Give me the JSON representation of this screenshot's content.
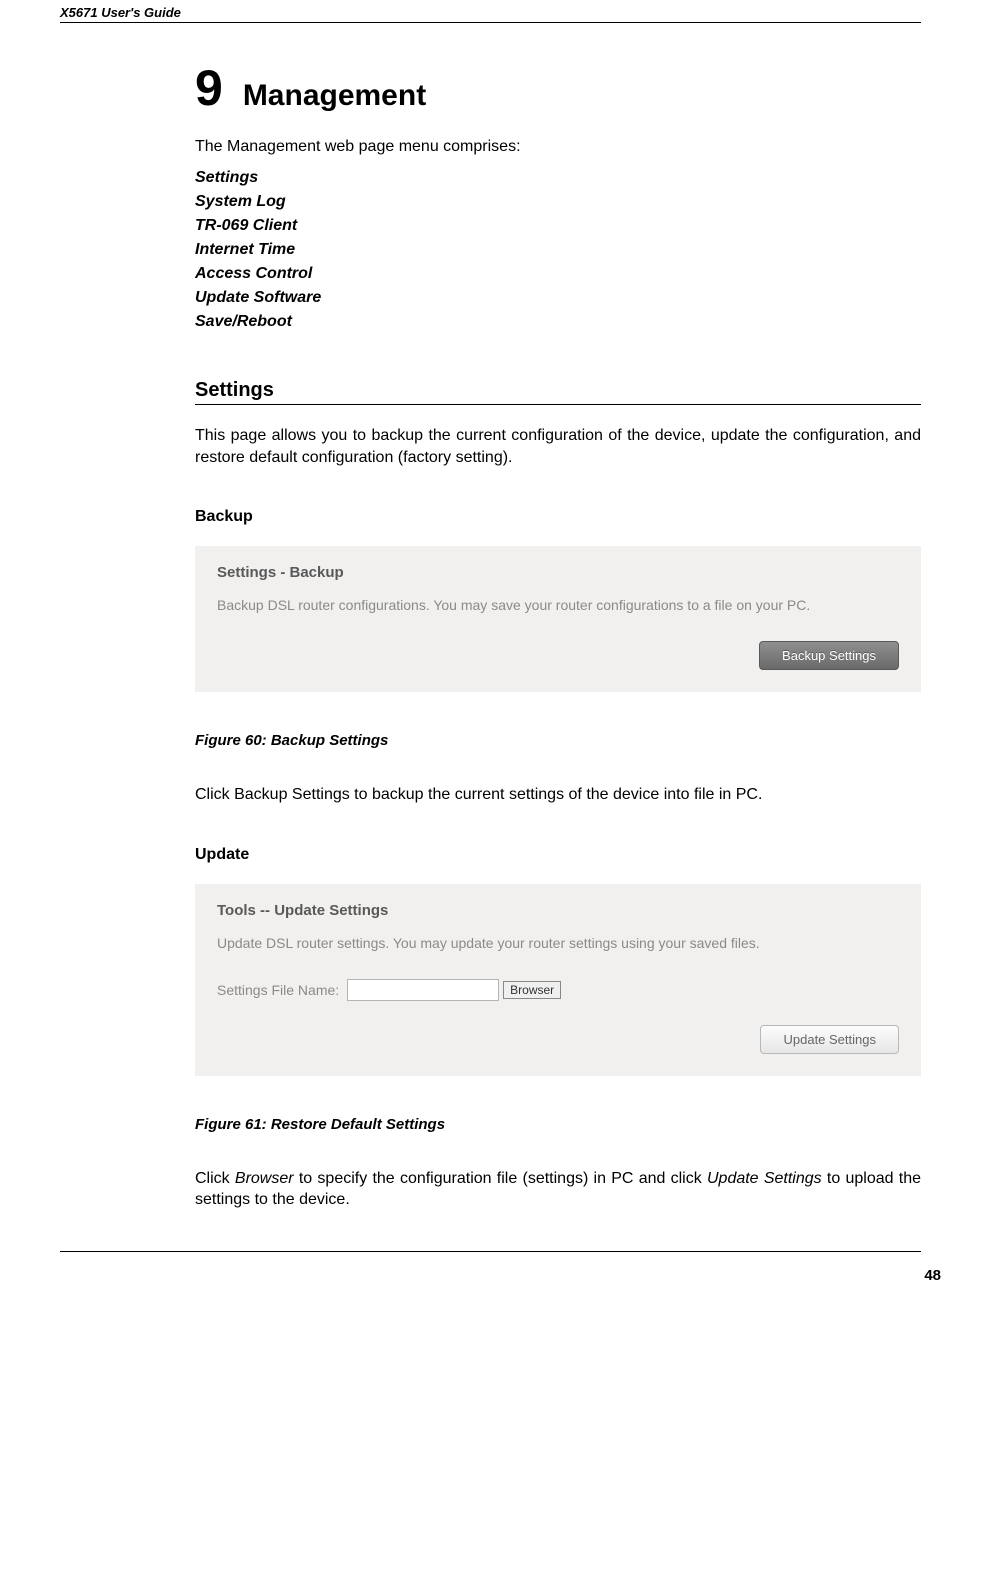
{
  "header": {
    "guide": "X5671 User's Guide"
  },
  "chapter": {
    "num": "9",
    "title": "Management"
  },
  "intro": "The Management web page menu comprises:",
  "menu": {
    "a": "Settings",
    "b": "System Log",
    "c": "TR-069 Client",
    "d": "Internet Time",
    "e": "Access Control",
    "f": "Update Software",
    "g": "Save/Reboot"
  },
  "section_settings": {
    "heading": "Settings",
    "body": "This page allows you to backup the current configuration of the device, update the configuration, and restore default configuration (factory setting)."
  },
  "backup": {
    "heading": "Backup",
    "ss_title": "Settings - Backup",
    "ss_text": "Backup DSL router configurations. You may save your router configurations to a file on your PC.",
    "ss_button": "Backup Settings",
    "caption": "Figure 60: Backup Settings",
    "after": "Click Backup Settings to backup the current settings of the device into file in PC."
  },
  "update": {
    "heading": "Update",
    "ss_title": "Tools -- Update Settings",
    "ss_text": "Update DSL router settings. You may update your router settings using your saved files.",
    "ss_label": "Settings File Name:",
    "ss_browser": "Browser",
    "ss_button": "Update Settings",
    "caption": "Figure 61: Restore Default Settings",
    "after_1": "Click ",
    "after_i1": "Browser",
    "after_2": " to specify the configuration file (settings) in PC and click ",
    "after_i2": "Update Settings",
    "after_3": " to upload the settings to the device."
  },
  "page_number": "48"
}
